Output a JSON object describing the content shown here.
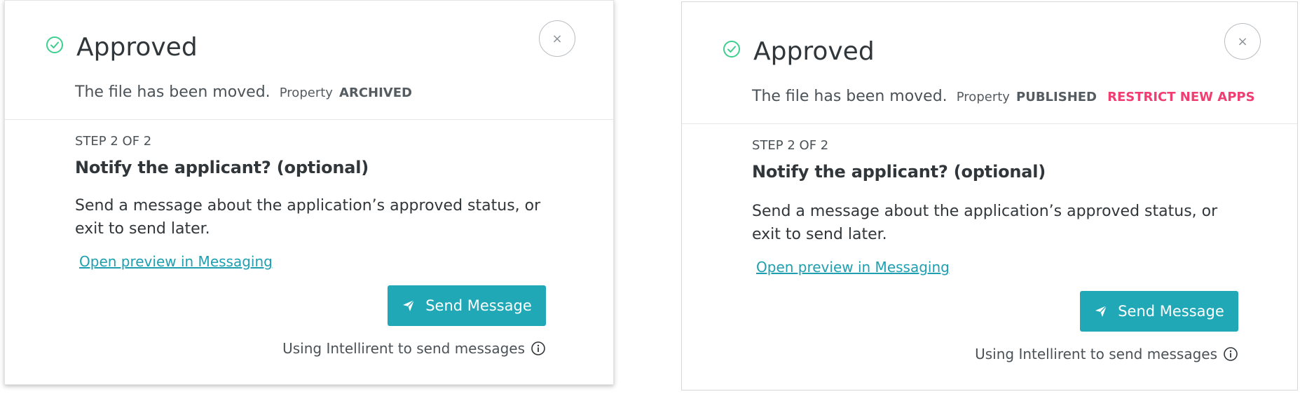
{
  "colors": {
    "accent": "#20a8b7",
    "link": "#1f9fb0",
    "success": "#3ecf8e",
    "warning": "#f03e72"
  },
  "modals": [
    {
      "title": "Approved",
      "status_icon": "check-circle-icon",
      "close_icon": "close-icon",
      "close_glyph": "×",
      "message": "The file has been moved.",
      "property_label": "Property",
      "property_status": "ARCHIVED",
      "step_label": "STEP 2 OF 2",
      "heading": "Notify the applicant? (optional)",
      "description": "Send a message about the application’s approved status, or exit to send later.",
      "preview_link": "Open preview in Messaging",
      "send_button": "Send Message",
      "send_icon": "paper-plane-icon",
      "footer_note": "Using Intellirent to send messages",
      "info_icon": "info-icon"
    },
    {
      "title": "Approved",
      "status_icon": "check-circle-icon",
      "close_icon": "close-icon",
      "close_glyph": "×",
      "message": "The file has been moved.",
      "property_label": "Property",
      "property_status": "PUBLISHED",
      "restrict_label": "RESTRICT NEW APPS",
      "step_label": "STEP 2 OF 2",
      "heading": "Notify the applicant? (optional)",
      "description": "Send a message about the application’s approved status, or exit to send later.",
      "preview_link": "Open preview in Messaging",
      "send_button": "Send Message",
      "send_icon": "paper-plane-icon",
      "footer_note": "Using Intellirent to send messages",
      "info_icon": "info-icon"
    }
  ]
}
